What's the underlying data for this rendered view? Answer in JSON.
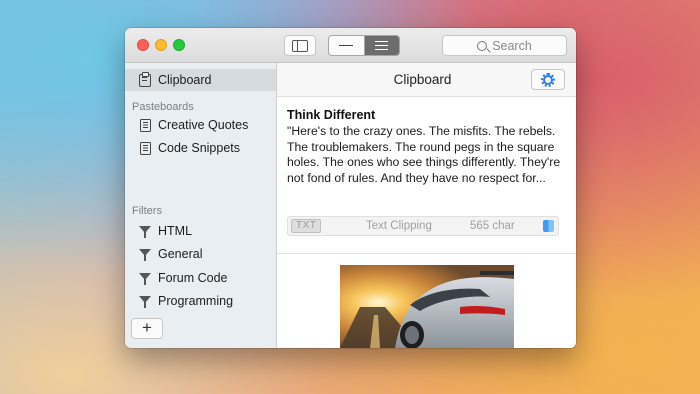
{
  "window": {
    "traffic_lights": [
      "close",
      "minimize",
      "zoom"
    ],
    "search_placeholder": "Search"
  },
  "sidebar": {
    "top_item": {
      "label": "Clipboard",
      "icon": "clipboard-icon",
      "selected": true
    },
    "sections": [
      {
        "header": "Pasteboards",
        "items": [
          {
            "label": "Creative Quotes",
            "icon": "document-icon"
          },
          {
            "label": "Code Snippets",
            "icon": "document-icon"
          }
        ]
      },
      {
        "header": "Filters",
        "items": [
          {
            "label": "HTML",
            "icon": "filter-icon"
          },
          {
            "label": "General",
            "icon": "filter-icon"
          },
          {
            "label": "Forum Code",
            "icon": "filter-icon"
          },
          {
            "label": "Programming",
            "icon": "filter-icon"
          }
        ]
      }
    ],
    "add_button": "+"
  },
  "main": {
    "title": "Clipboard",
    "clips": [
      {
        "title": "Think Different",
        "lines": [
          "\"Here's to the crazy ones. The misfits. The rebels.",
          "The troublemakers. The round pegs in the square",
          "holes. The ones who see things differently. They're",
          "not fond of rules. And they have no respect for..."
        ],
        "type_badge": "TXT",
        "kind": "Text Clipping",
        "count": "565 char"
      },
      {
        "type": "image"
      }
    ]
  },
  "colors": {
    "accent": "#2f7de0",
    "sidebar_bg": "#e9eef2",
    "selected_row": "#d6dbe0"
  }
}
